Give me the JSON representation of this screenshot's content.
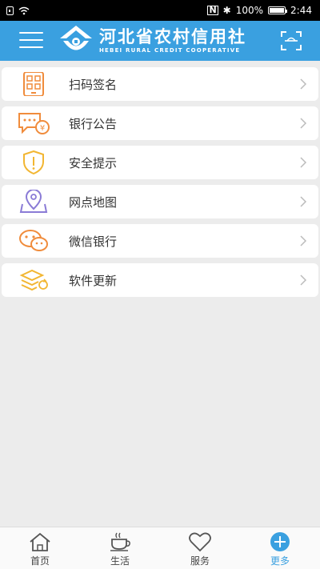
{
  "status_bar": {
    "battery_text": "100%",
    "time": "2:44",
    "battery_level": 1.0
  },
  "header": {
    "brand_cn": "河北省农村信用社",
    "brand_en": "HEBEI RURAL CREDIT COOPERATIVE",
    "icons": [
      "menu-icon",
      "logo",
      "scan-icon"
    ]
  },
  "menu": {
    "items": [
      {
        "label": "扫码签名",
        "icon": "scan-sign-icon"
      },
      {
        "label": "银行公告",
        "icon": "announcement-icon"
      },
      {
        "label": "安全提示",
        "icon": "security-shield-icon"
      },
      {
        "label": "网点地图",
        "icon": "map-pin-icon"
      },
      {
        "label": "微信银行",
        "icon": "wechat-icon"
      },
      {
        "label": "软件更新",
        "icon": "update-icon"
      }
    ]
  },
  "bottom_nav": {
    "items": [
      {
        "label": "首页",
        "icon": "home-icon"
      },
      {
        "label": "生活",
        "icon": "coffee-icon"
      },
      {
        "label": "服务",
        "icon": "heart-icon"
      },
      {
        "label": "更多",
        "icon": "plus-icon",
        "active": true
      }
    ]
  },
  "colors": {
    "header_bg": "#3aa0e0",
    "accent_orange": "#f08c3c",
    "accent_yellow": "#f2b632",
    "accent_purple": "#8a7bd6",
    "active_nav": "#3aa0e0"
  }
}
